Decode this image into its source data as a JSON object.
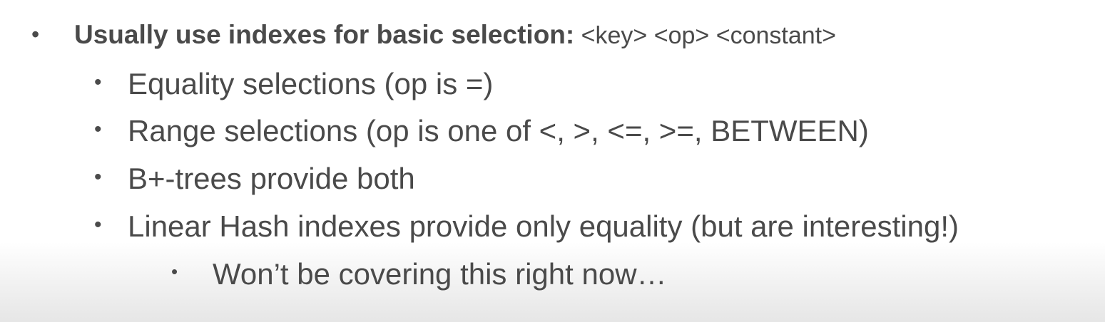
{
  "slide": {
    "title_bold": "Usually use indexes for basic selection:",
    "title_rest": " <key> <op> <constant>",
    "items": [
      "Equality selections (op is =)",
      "Range selections (op is one of <, >, <=, >=, BETWEEN)",
      "B+-trees provide both",
      "Linear Hash indexes provide only equality (but are interesting!)"
    ],
    "subitems": [
      "Won’t be covering this right now…"
    ],
    "bullet_main": "•",
    "bullet_sub": "•"
  }
}
